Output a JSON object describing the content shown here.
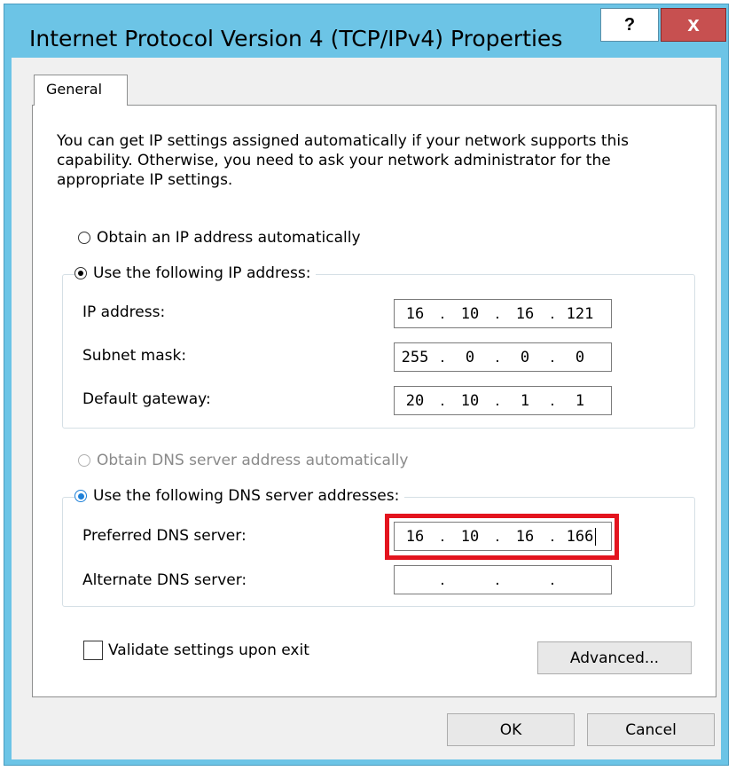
{
  "window": {
    "title": "Internet Protocol Version 4 (TCP/IPv4) Properties",
    "help_label": "?",
    "close_label": "x"
  },
  "tabs": [
    {
      "label": "General"
    }
  ],
  "description": "You can get IP settings assigned automatically if your network supports this capability. Otherwise, you need to ask your network administrator for the appropriate IP settings.",
  "ip_section": {
    "auto_option": "Obtain an IP address automatically",
    "manual_option": "Use the following IP address:",
    "selected": "manual",
    "fields": [
      {
        "label": "IP address:",
        "octets": [
          "16",
          "10",
          "16",
          "121"
        ]
      },
      {
        "label": "Subnet mask:",
        "octets": [
          "255",
          "0",
          "0",
          "0"
        ]
      },
      {
        "label": "Default gateway:",
        "octets": [
          "20",
          "10",
          "1",
          "1"
        ]
      }
    ]
  },
  "dns_section": {
    "auto_option": "Obtain DNS server address automatically",
    "manual_option": "Use the following DNS server addresses:",
    "selected": "manual",
    "fields": [
      {
        "label": "Preferred DNS server:",
        "octets": [
          "16",
          "10",
          "16",
          "166"
        ]
      },
      {
        "label": "Alternate DNS server:",
        "octets": [
          "",
          "",
          "",
          ""
        ]
      }
    ]
  },
  "validate_label": "Validate settings upon exit",
  "validate_checked": false,
  "buttons": {
    "advanced": "Advanced...",
    "ok": "OK",
    "cancel": "Cancel"
  },
  "colors": {
    "title_bar": "#6cc4e6",
    "close_button": "#c75050",
    "highlight": "#e3141e"
  }
}
